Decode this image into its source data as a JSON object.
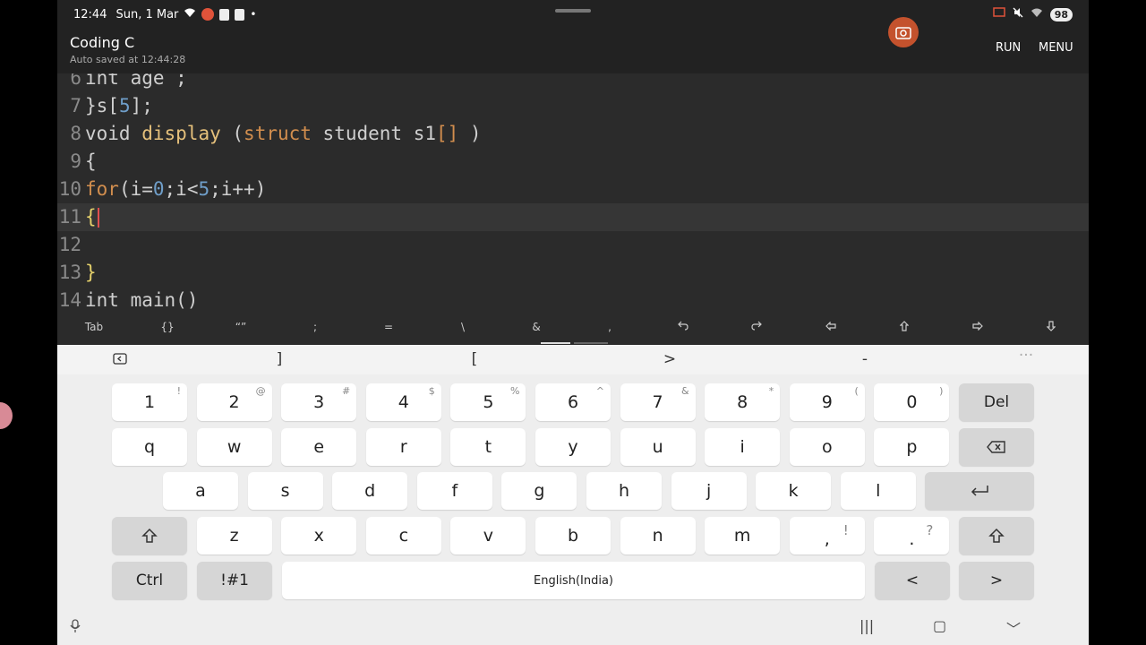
{
  "status_bar": {
    "time": "12:44",
    "date": "Sun, 1 Mar",
    "battery": "98"
  },
  "app": {
    "title": "Coding C",
    "subtitle": "Auto saved at 12:44:28",
    "run_label": "RUN",
    "menu_label": "MENU"
  },
  "editor": {
    "lines": [
      {
        "n": "6",
        "tokens": [
          {
            "t": "int",
            "c": "plain"
          },
          {
            "t": " age ;",
            "c": "plain"
          }
        ]
      },
      {
        "n": "7",
        "tokens": [
          {
            "t": "}s[",
            "c": "plain"
          },
          {
            "t": "5",
            "c": "num"
          },
          {
            "t": "];",
            "c": "plain"
          }
        ]
      },
      {
        "n": "8",
        "tokens": [
          {
            "t": "void",
            "c": "plain"
          },
          {
            "t": " ",
            "c": "plain"
          },
          {
            "t": "display",
            "c": "fn"
          },
          {
            "t": " (",
            "c": "plain"
          },
          {
            "t": "struct",
            "c": "kw"
          },
          {
            "t": " student s1",
            "c": "plain"
          },
          {
            "t": "[]",
            "c": "kw"
          },
          {
            "t": " )",
            "c": "plain"
          }
        ]
      },
      {
        "n": "9",
        "tokens": [
          {
            "t": "{",
            "c": "plain"
          }
        ]
      },
      {
        "n": "10",
        "tokens": [
          {
            "t": "for",
            "c": "kw"
          },
          {
            "t": "(i=",
            "c": "plain"
          },
          {
            "t": "0",
            "c": "num"
          },
          {
            "t": ";i<",
            "c": "plain"
          },
          {
            "t": "5",
            "c": "num"
          },
          {
            "t": ";i++)",
            "c": "plain"
          }
        ]
      },
      {
        "n": "11",
        "tokens": [
          {
            "t": "{",
            "c": "brace"
          }
        ],
        "current": true
      },
      {
        "n": "12",
        "tokens": []
      },
      {
        "n": "13",
        "tokens": [
          {
            "t": "}",
            "c": "brace"
          }
        ]
      },
      {
        "n": "14",
        "tokens": [
          {
            "t": "int",
            "c": "plain"
          },
          {
            "t": " main()",
            "c": "plain"
          }
        ]
      }
    ]
  },
  "extra_keys": [
    "Tab",
    "{}",
    "“”",
    ";",
    "=",
    "\\",
    "&",
    ",",
    "undo-icon",
    "redo-icon",
    "arrow-left-icon",
    "arrow-up-icon",
    "arrow-right-icon",
    "arrow-down-icon"
  ],
  "keyboard": {
    "suggestions": [
      "]",
      "[",
      ">",
      "-"
    ],
    "row_numbers": [
      {
        "k": "1",
        "s": "!"
      },
      {
        "k": "2",
        "s": "@"
      },
      {
        "k": "3",
        "s": "#"
      },
      {
        "k": "4",
        "s": "$"
      },
      {
        "k": "5",
        "s": "%"
      },
      {
        "k": "6",
        "s": "^"
      },
      {
        "k": "7",
        "s": "&"
      },
      {
        "k": "8",
        "s": "*"
      },
      {
        "k": "9",
        "s": "("
      },
      {
        "k": "0",
        "s": ")"
      }
    ],
    "del_label": "Del",
    "row_q": [
      "q",
      "w",
      "e",
      "r",
      "t",
      "y",
      "u",
      "i",
      "o",
      "p"
    ],
    "row_a": [
      "a",
      "s",
      "d",
      "f",
      "g",
      "h",
      "j",
      "k",
      "l"
    ],
    "row_z": [
      "z",
      "x",
      "c",
      "v",
      "b",
      "n",
      "m"
    ],
    "comma": {
      "k": ",",
      "s": "!"
    },
    "period": {
      "k": ".",
      "s": "?"
    },
    "ctrl_label": "Ctrl",
    "sym_label": "!#1",
    "space_label": "English(India)",
    "left_arrow": "<",
    "right_arrow": ">"
  },
  "nav_bar": {
    "recents": "|||",
    "home": "▢",
    "back": "﹀"
  }
}
